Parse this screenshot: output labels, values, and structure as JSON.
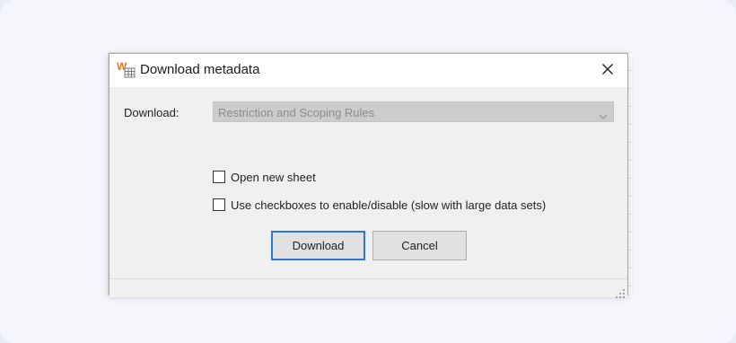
{
  "dialog": {
    "title": "Download metadata",
    "icon": "metadata-app-icon",
    "close_icon": "close-icon"
  },
  "form": {
    "download_label": "Download:",
    "download_select": {
      "value": "Restriction and Scoping Rules",
      "disabled": true
    },
    "checkboxes": [
      {
        "label": "Open new sheet",
        "checked": false
      },
      {
        "label": "Use checkboxes to enable/disable (slow with large data sets)",
        "checked": false
      }
    ]
  },
  "buttons": {
    "download_label": "Download",
    "cancel_label": "Cancel"
  },
  "colors": {
    "accent": "#2b78d4",
    "icon_orange": "#e07a1f",
    "dialog_bg": "#f0f0f0"
  }
}
